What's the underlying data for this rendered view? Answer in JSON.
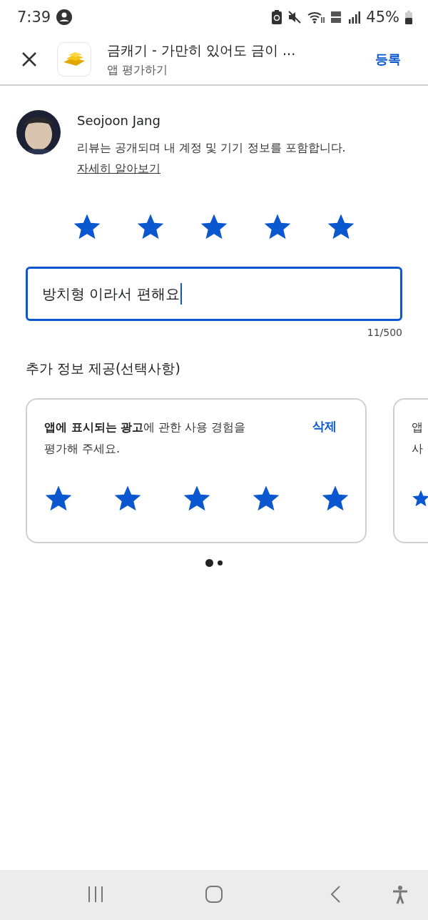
{
  "status_bar": {
    "time": "7:39",
    "battery": "45%"
  },
  "header": {
    "title": "금캐기 - 가만히 있어도 금이 ...",
    "subtitle": "앱 평가하기",
    "action": "등록"
  },
  "reviewer": {
    "name": "Seojoon Jang",
    "notice": "리뷰는 공개되며 내 계정 및 기기 정보를 포함합니다.",
    "link": "자세히 알아보기"
  },
  "rating": {
    "stars": 5
  },
  "review_field": {
    "value": "방치형 이라서 편해요",
    "counter": "11/500"
  },
  "extra_section": {
    "title": "추가 정보 제공(선택사항)"
  },
  "cards": [
    {
      "kind": "full",
      "lines": [
        "**앱에 표시되는 광고**에 관한 사용 경험을",
        "평가해 주세요."
      ],
      "action": "삭제",
      "stars": 5
    },
    {
      "kind": "peek",
      "lines": [
        "앱",
        "사"
      ]
    }
  ],
  "pager": [
    {
      "selected": true
    },
    {
      "selected": false
    }
  ]
}
